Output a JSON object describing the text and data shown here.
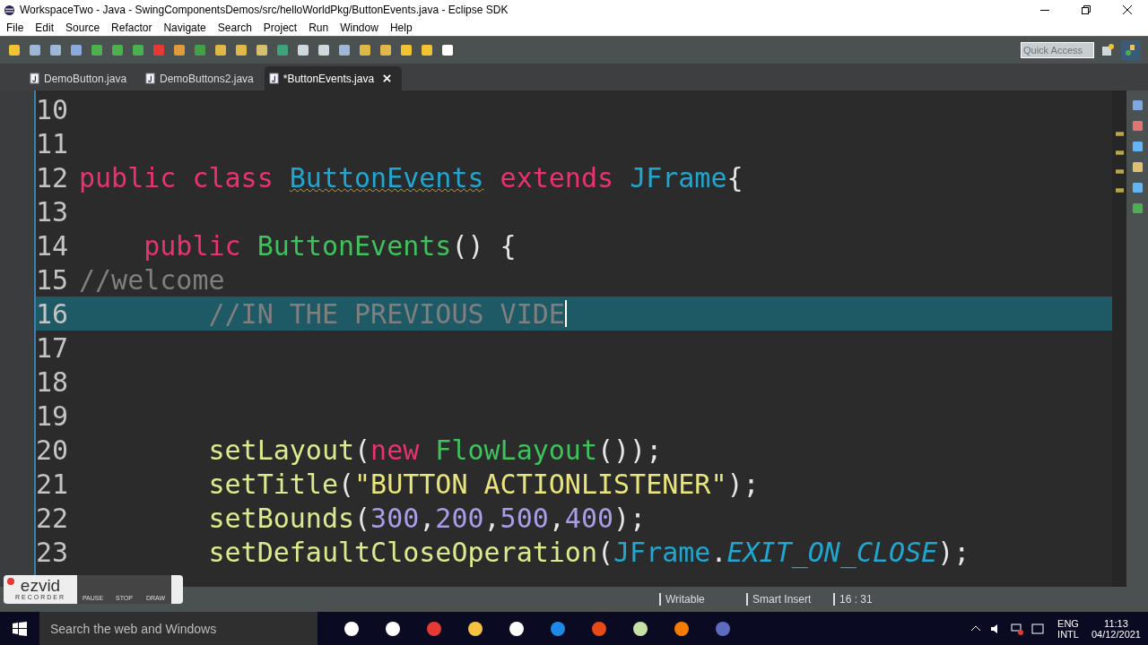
{
  "window": {
    "title": "WorkspaceTwo - Java - SwingComponentsDemos/src/helloWorldPkg/ButtonEvents.java - Eclipse SDK"
  },
  "menu": [
    "File",
    "Edit",
    "Source",
    "Refactor",
    "Navigate",
    "Search",
    "Project",
    "Run",
    "Window",
    "Help"
  ],
  "quick_access": {
    "placeholder": "Quick Access"
  },
  "tabs": [
    {
      "label": "DemoButton.java",
      "selected": false
    },
    {
      "label": "DemoButtons2.java",
      "selected": false
    },
    {
      "label": "*ButtonEvents.java",
      "selected": true
    }
  ],
  "code_lines": [
    {
      "number": "10",
      "current": false
    },
    {
      "number": "11",
      "current": false
    },
    {
      "number": "12",
      "current": false,
      "tokens": [
        {
          "kind": "keyword",
          "text": "public class "
        },
        {
          "kind": "type",
          "text": "ButtonEvents",
          "warning": true
        },
        {
          "kind": "keyword",
          "text": " extends "
        },
        {
          "kind": "type",
          "text": "JFrame"
        },
        {
          "kind": "plain",
          "text": "{"
        }
      ]
    },
    {
      "number": "13",
      "current": false
    },
    {
      "number": "14",
      "current": false,
      "tokens": [
        {
          "kind": "keyword",
          "text": "    public "
        },
        {
          "kind": "method",
          "text": "ButtonEvents"
        },
        {
          "kind": "plain",
          "text": "() {"
        }
      ]
    },
    {
      "number": "15",
      "current": false,
      "tokens": [
        {
          "kind": "comment",
          "text": "//welcome"
        }
      ]
    },
    {
      "number": "16",
      "current": true,
      "tokens": [
        {
          "kind": "comment",
          "text": "        //IN THE PREVIOUS VIDE"
        }
      ]
    },
    {
      "number": "17",
      "current": false
    },
    {
      "number": "18",
      "current": false
    },
    {
      "number": "19",
      "current": false
    },
    {
      "number": "20",
      "current": false,
      "tokens": [
        {
          "kind": "call",
          "text": "        setLayout"
        },
        {
          "kind": "plain",
          "text": "("
        },
        {
          "kind": "keyword",
          "text": "new "
        },
        {
          "kind": "method",
          "text": "FlowLayout"
        },
        {
          "kind": "plain",
          "text": "());"
        }
      ]
    },
    {
      "number": "21",
      "current": false,
      "tokens": [
        {
          "kind": "call",
          "text": "        setTitle"
        },
        {
          "kind": "plain",
          "text": "("
        },
        {
          "kind": "string",
          "text": "\"BUTTON ACTIONLISTENER\""
        },
        {
          "kind": "plain",
          "text": ");"
        }
      ]
    },
    {
      "number": "22",
      "current": false,
      "tokens": [
        {
          "kind": "call",
          "text": "        setBounds"
        },
        {
          "kind": "plain",
          "text": "("
        },
        {
          "kind": "number",
          "text": "300"
        },
        {
          "kind": "plain",
          "text": ","
        },
        {
          "kind": "number",
          "text": "200"
        },
        {
          "kind": "plain",
          "text": ","
        },
        {
          "kind": "number",
          "text": "500"
        },
        {
          "kind": "plain",
          "text": ","
        },
        {
          "kind": "number",
          "text": "400"
        },
        {
          "kind": "plain",
          "text": ");"
        }
      ]
    },
    {
      "number": "23",
      "current": false,
      "tokens": [
        {
          "kind": "call",
          "text": "        setDefaultCloseOperation"
        },
        {
          "kind": "plain",
          "text": "("
        },
        {
          "kind": "type",
          "text": "JFrame"
        },
        {
          "kind": "plain",
          "text": "."
        },
        {
          "kind": "constant",
          "text": "EXIT_ON_CLOSE"
        },
        {
          "kind": "plain",
          "text": ");"
        }
      ]
    }
  ],
  "recorder": {
    "logo": "ezvid",
    "subtitle": "RECORDER",
    "buttons": [
      "PAUSE",
      "STOP",
      "DRAW"
    ]
  },
  "status_bar": [
    "Writable",
    "Smart Insert",
    "16 : 31"
  ],
  "taskbar": {
    "search": {
      "placeholder": "Search the web and Windows"
    },
    "language": "ENG",
    "layout": "INTL",
    "time": "11:13",
    "date": "04/12/2021"
  }
}
